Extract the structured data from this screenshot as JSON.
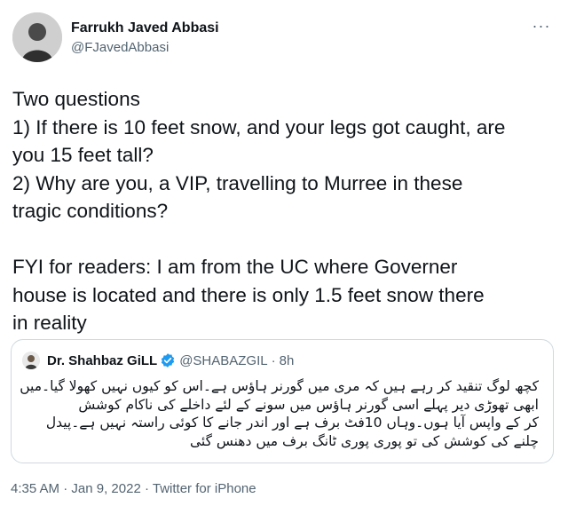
{
  "author": {
    "display_name": "Farrukh Javed Abbasi",
    "handle": "@FJavedAbbasi"
  },
  "more_label": "···",
  "tweet_lines": [
    "Two questions",
    "1) If there is 10 feet snow, and your legs got caught, are",
    "you 15 feet tall?",
    "2) Why are you, a VIP, travelling to Murree in these",
    "tragic conditions?",
    "",
    "FYI for readers: I am from the UC where Governer",
    "house is located and there is only 1.5 feet snow there",
    "in reality"
  ],
  "quoted": {
    "display_name": "Dr. Shahbaz GiLL",
    "handle": "@SHABAZGIL",
    "separator": "·",
    "time": "8h",
    "verified_color": "#1d9bf0",
    "text_lines": [
      "کچھ لوگ تنقید کر رہے ہیں کہ مری میں گورنر ہاؤس ہے۔اس کو کیوں نہیں کھولا گیا۔میں",
      "ابھی تھوڑی دیر پہلے اسی گورنر ہاؤس میں سونے کے لئے داخلے کی ناکام کوشش",
      "کر کے واپس آیا ہوں۔وہاں 10فٹ برف ہے اور اندر جانے کا کوئی راستہ نہیں ہے۔پیدل",
      "چلنے کی کوشش کی تو پوری پوری ٹانگ برف میں دھنس گئی"
    ]
  },
  "meta": {
    "time": "4:35 AM",
    "separator1": "·",
    "date": "Jan 9, 2022",
    "separator2": "·",
    "source": "Twitter for iPhone"
  }
}
